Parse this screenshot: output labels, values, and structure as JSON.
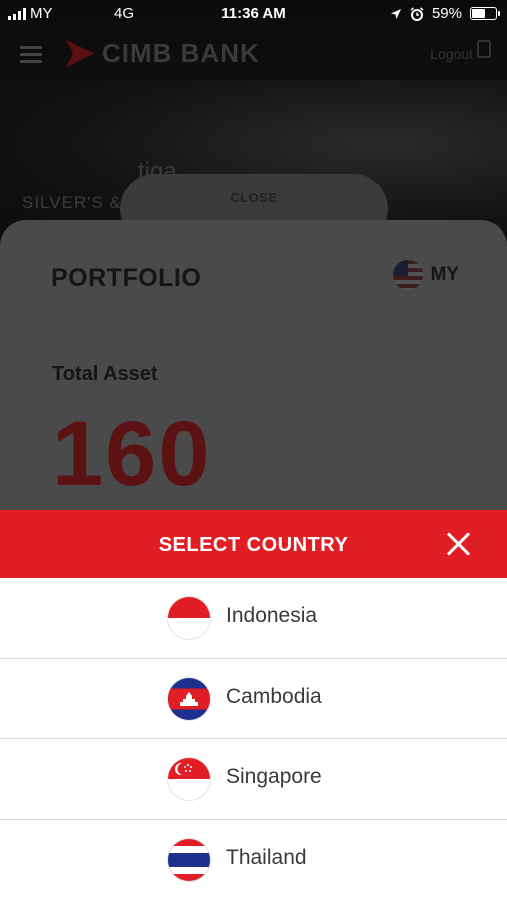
{
  "status_bar": {
    "carrier": "MY",
    "network": "4G",
    "time": "11:36 AM",
    "battery": "59%",
    "battery_level": 0.59
  },
  "app": {
    "brand": "CIMB BANK",
    "logout_label": "Logout",
    "greeting": "tiga",
    "tier": "SILVER'S & GOLD STR",
    "close_label": "CLOSE"
  },
  "portfolio": {
    "title": "PORTFOLIO",
    "country_code": "MY",
    "asset_label": "Total Asset",
    "asset_value": "160"
  },
  "modal": {
    "title": "SELECT COUNTRY",
    "countries": [
      {
        "name": "Indonesia",
        "flag": "indonesia-flag-icon"
      },
      {
        "name": "Cambodia",
        "flag": "cambodia-flag-icon"
      },
      {
        "name": "Singapore",
        "flag": "singapore-flag-icon"
      },
      {
        "name": "Thailand",
        "flag": "thailand-flag-icon"
      }
    ]
  },
  "colors": {
    "accent": "#e01e23",
    "overlay_card": "#4a4a4a",
    "list_text": "#3a3a3a"
  }
}
